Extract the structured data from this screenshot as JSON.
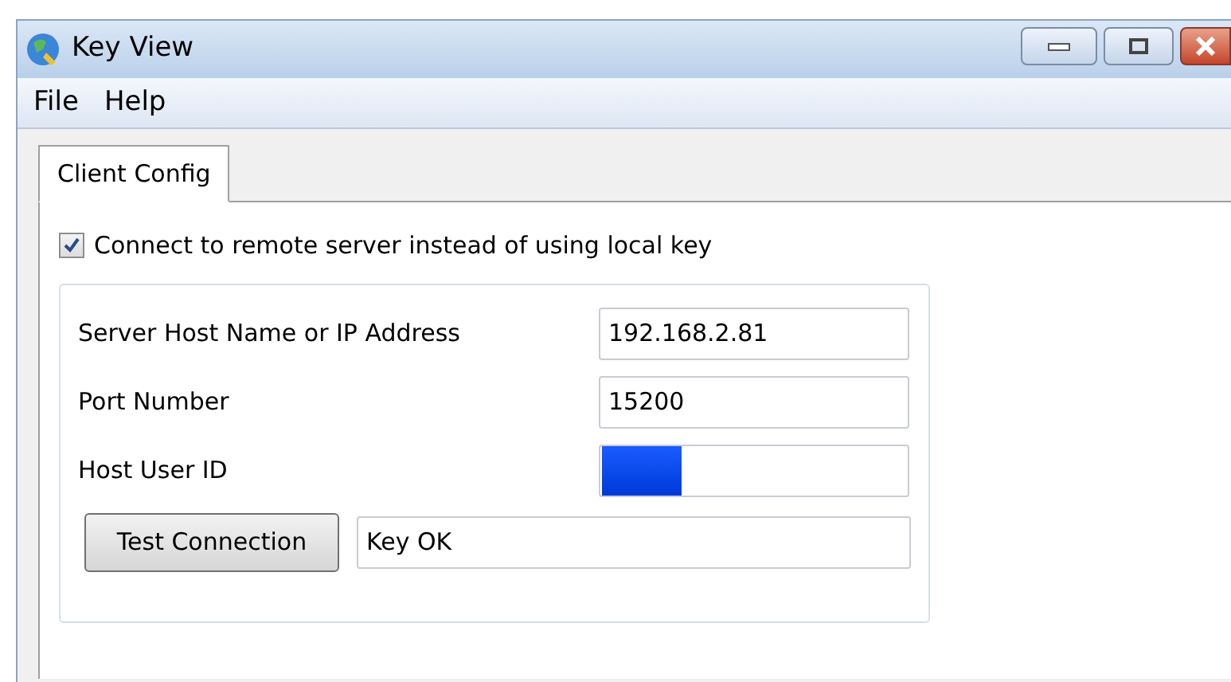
{
  "window": {
    "title": "Key View"
  },
  "menu": [
    {
      "label": "File"
    },
    {
      "label": "Help"
    }
  ],
  "tabs": [
    {
      "label": "Client Config",
      "selected": true
    }
  ],
  "remote_checkbox": {
    "label": "Connect to remote server instead of using local key",
    "checked": true
  },
  "fields": [
    {
      "label": "Server Host Name or IP Address",
      "kind": "text",
      "value": "192.168.2.81"
    },
    {
      "label": "Port Number",
      "kind": "text",
      "value": "15200"
    },
    {
      "label": "Host User ID",
      "kind": "redacted"
    }
  ],
  "test_button": {
    "label": "Test Connection"
  },
  "result": {
    "value": "Key OK"
  }
}
